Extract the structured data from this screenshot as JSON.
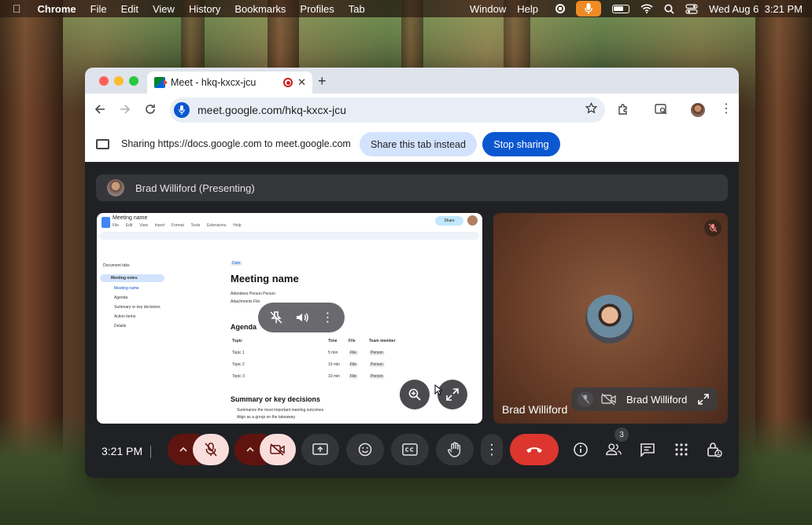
{
  "menubar": {
    "app": "Chrome",
    "items": [
      "File",
      "Edit",
      "View",
      "History",
      "Bookmarks",
      "Profiles",
      "Tab"
    ],
    "right_items": [
      "Window",
      "Help"
    ],
    "datetime": "Wed Aug 6  3:21 PM"
  },
  "browser": {
    "tab_title": "Meet - hkq-kxcx-jcu",
    "url": "meet.google.com/hkq-kxcx-jcu",
    "sharing_text": "Sharing https://docs.google.com to meet.google.com",
    "share_this_tab_label": "Share this tab instead",
    "stop_sharing_label": "Stop sharing"
  },
  "meet": {
    "presenter_label": "Brad Williford (Presenting)",
    "participant_name": "Brad Williford",
    "self_name": "Brad Williford",
    "clock": "3:21 PM",
    "participants_count": "3"
  },
  "doc": {
    "title": "Meeting name",
    "menu": "File  Edit  View  Insert  Format  Tools  Extensions  Help",
    "share": "Share",
    "sidebar_header": "Document tabs",
    "sidebar_items": [
      "Meeting notes",
      "Meeting name",
      "Agenda",
      "Summary or key decisions",
      "Action items",
      "Details"
    ],
    "date_chip": "Date",
    "heading": "Meeting name",
    "attendees": "Attendees  Person  Person",
    "attachments": "Attachments  File",
    "agenda_heading": "Agenda",
    "table_headers": [
      "Topic",
      "Time",
      "File",
      "Team member"
    ],
    "table_rows": [
      [
        "Topic 1",
        "5 min",
        "File",
        "Person"
      ],
      [
        "Topic 2",
        "10 min",
        "File",
        "Person"
      ],
      [
        "Topic 3",
        "10 min",
        "File",
        "Person"
      ]
    ],
    "summary_heading": "Summary or key decisions",
    "bullets": [
      "Summarize the most important meeting outcomes",
      "Align as a group on the takeaway"
    ]
  },
  "colors": {
    "accent": "#0b57d0",
    "end_call": "#dc362e",
    "muted_bg": "#f9dedc"
  }
}
